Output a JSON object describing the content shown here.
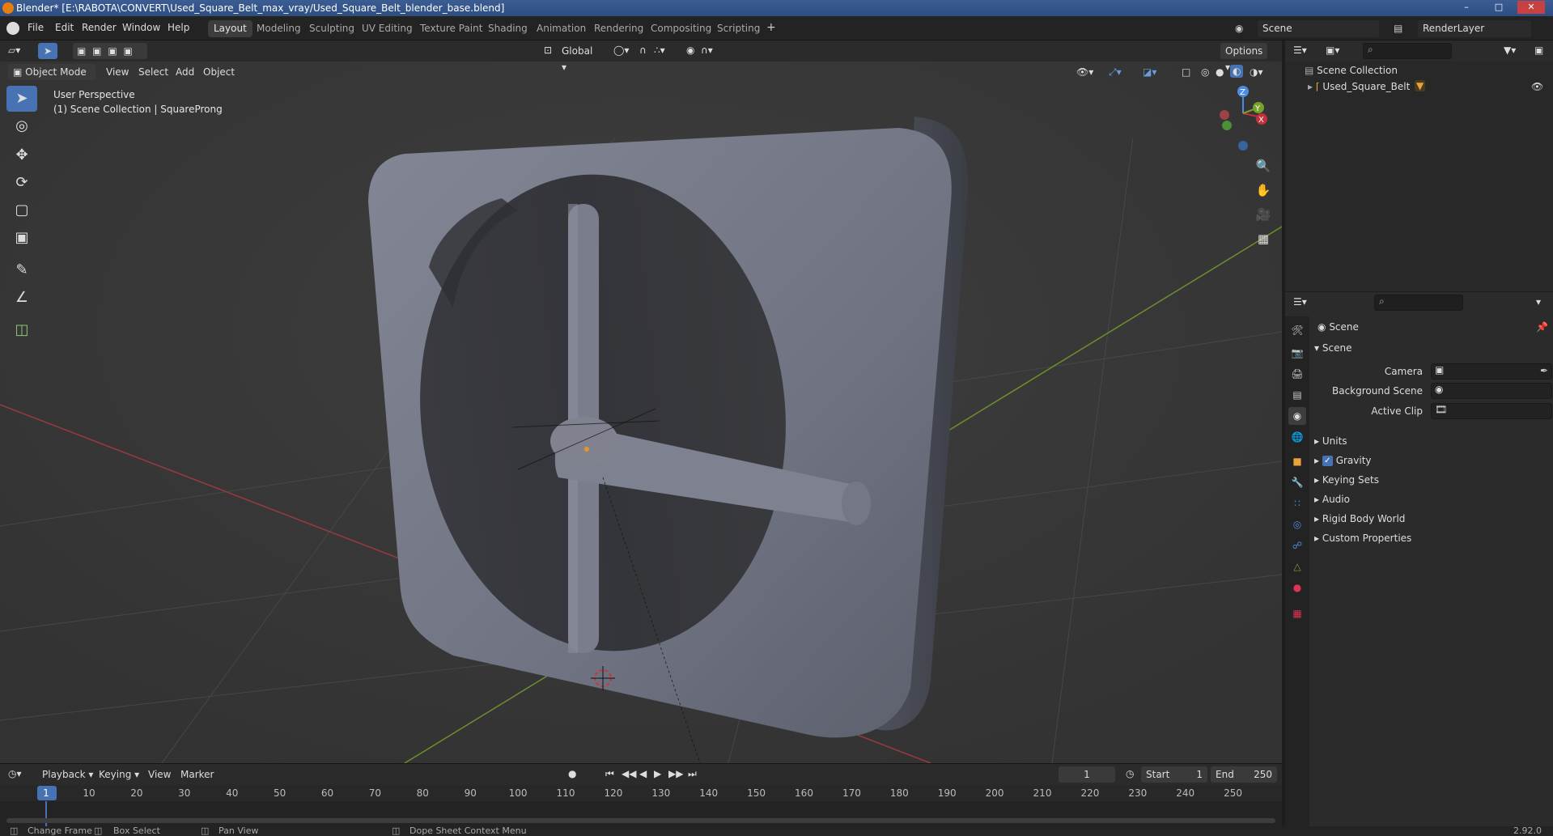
{
  "window": {
    "title": "Blender* [E:\\RABOTA\\CONVERT\\Used_Square_Belt_max_vray/Used_Square_Belt_blender_base.blend]",
    "minimize": "–",
    "maximize": "□",
    "close": "✕"
  },
  "menu": [
    "File",
    "Edit",
    "Render",
    "Window",
    "Help"
  ],
  "workspaces": [
    "Layout",
    "Modeling",
    "Sculpting",
    "UV Editing",
    "Texture Paint",
    "Shading",
    "Animation",
    "Rendering",
    "Compositing",
    "Scripting"
  ],
  "active_workspace": "Layout",
  "scene_selector": "Scene",
  "renderlayer_selector": "RenderLayer",
  "viewport_header": {
    "mode": "Object Mode",
    "menus": [
      "View",
      "Select",
      "Add",
      "Object"
    ],
    "transform_orientation": "Global",
    "options": "Options"
  },
  "viewport_overlay": {
    "line1": "User Perspective",
    "line2": "(1) Scene Collection | SquareProng"
  },
  "gizmo_axes": {
    "z": "Z",
    "y": "Y",
    "x": "X"
  },
  "outliner": {
    "root": "Scene Collection",
    "items": [
      "Used_Square_Belt"
    ]
  },
  "properties": {
    "context": "Scene",
    "panel": "Scene",
    "fields": [
      {
        "label": "Camera",
        "value": ""
      },
      {
        "label": "Background Scene",
        "value": ""
      },
      {
        "label": "Active Clip",
        "value": ""
      }
    ],
    "subpanels": [
      "Units",
      "Gravity",
      "Keying Sets",
      "Audio",
      "Rigid Body World",
      "Custom Properties"
    ],
    "gravity_checked": true
  },
  "timeline": {
    "menus": [
      "Playback",
      "Keying",
      "View",
      "Marker"
    ],
    "current_frame": "1",
    "start_label": "Start",
    "start": "1",
    "end_label": "End",
    "end": "250",
    "ticks": [
      "1",
      "10",
      "20",
      "30",
      "40",
      "50",
      "60",
      "70",
      "80",
      "90",
      "100",
      "110",
      "120",
      "130",
      "140",
      "150",
      "160",
      "170",
      "180",
      "190",
      "200",
      "210",
      "220",
      "230",
      "240",
      "250"
    ]
  },
  "statusbar": {
    "items": [
      "Change Frame",
      "Box Select",
      "Pan View",
      "Dope Sheet Context Menu"
    ],
    "version": "2.92.0"
  },
  "colors": {
    "accent": "#4772b3",
    "header": "#2b2b2b",
    "viewport_bg": "#393939",
    "object": "#777b88",
    "x_axis": "#c2303a",
    "y_axis": "#76a12a"
  }
}
